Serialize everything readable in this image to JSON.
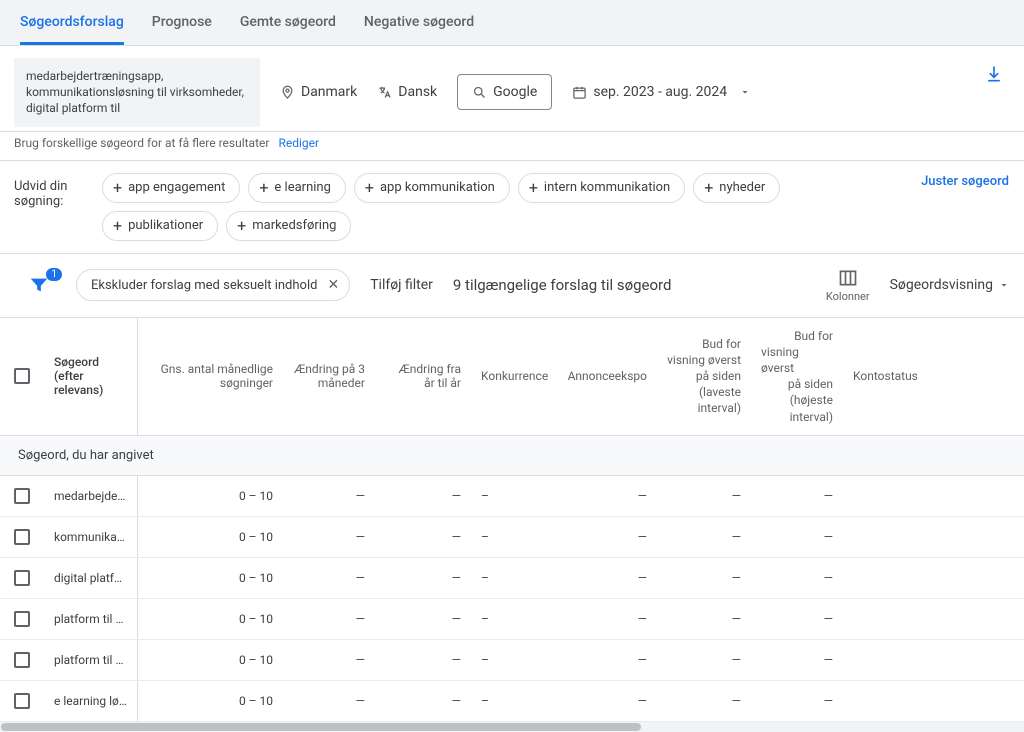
{
  "tabs": {
    "t1": "Søgeordsforslag",
    "t2": "Prognose",
    "t3": "Gemte søgeord",
    "t4": "Negative søgeord"
  },
  "controls": {
    "keywords_entered": "medarbejdertræningsapp, kommunikationsløsning til virksomheder, digital platform til",
    "location": "Danmark",
    "language": "Dansk",
    "network": "Google",
    "date_range": "sep. 2023 - aug. 2024"
  },
  "hint": {
    "text": "Brug forskellige søgeord for at få flere resultater",
    "edit": "Rediger"
  },
  "expand": {
    "label": "Udvid din søgning:",
    "chips": [
      "app engagement",
      "e learning",
      "app kommunikation",
      "intern kommunikation",
      "nyheder",
      "publikationer",
      "markedsføring"
    ],
    "adjust": "Juster søgeord"
  },
  "filter": {
    "badge": "1",
    "chip": "Ekskluder forslag med seksuelt indhold",
    "add": "Tilføj filter",
    "available": "9 tilgængelige forslag til søgeord",
    "columns": "Kolonner",
    "view": "Søgeordsvisning"
  },
  "columns": {
    "keyword": "Søgeord (efter relevans)",
    "volume": "Gns. antal månedlige søgninger",
    "m3": "Ændring på 3 måneder",
    "yoy": "Ændring fra år til år",
    "comp": "Konkurrence",
    "imp": "Annonceekspo",
    "low_bid_a": "Bud for",
    "low_bid_b": "visning øverst",
    "low_bid_c": "på siden",
    "low_bid_d": "(laveste",
    "low_bid_e": "interval)",
    "high_bid_a": "Bud for",
    "high_bid_b": "visning øverst",
    "high_bid_c": "på siden",
    "high_bid_d": "(højeste",
    "high_bid_e": "interval)",
    "status": "Kontostatus"
  },
  "section_title": "Søgeord, du har angivet",
  "rows": [
    {
      "kw": "medarbejder…",
      "vol": "0 – 10",
      "m3": "—",
      "yoy": "—",
      "comp": "–",
      "imp": "—",
      "low": "—",
      "high": "—",
      "status": ""
    },
    {
      "kw": "kommunikati…",
      "vol": "0 – 10",
      "m3": "—",
      "yoy": "—",
      "comp": "–",
      "imp": "—",
      "low": "—",
      "high": "—",
      "status": ""
    },
    {
      "kw": "digital platfor…",
      "vol": "0 – 10",
      "m3": "—",
      "yoy": "—",
      "comp": "–",
      "imp": "—",
      "low": "—",
      "high": "—",
      "status": ""
    },
    {
      "kw": "platform til a…",
      "vol": "0 – 10",
      "m3": "—",
      "yoy": "—",
      "comp": "–",
      "imp": "—",
      "low": "—",
      "high": "—",
      "status": ""
    },
    {
      "kw": "platform til d…",
      "vol": "0 – 10",
      "m3": "—",
      "yoy": "—",
      "comp": "–",
      "imp": "—",
      "low": "—",
      "high": "—",
      "status": ""
    },
    {
      "kw": "e learning løs…",
      "vol": "0 – 10",
      "m3": "—",
      "yoy": "—",
      "comp": "–",
      "imp": "—",
      "low": "—",
      "high": "—",
      "status": ""
    }
  ]
}
